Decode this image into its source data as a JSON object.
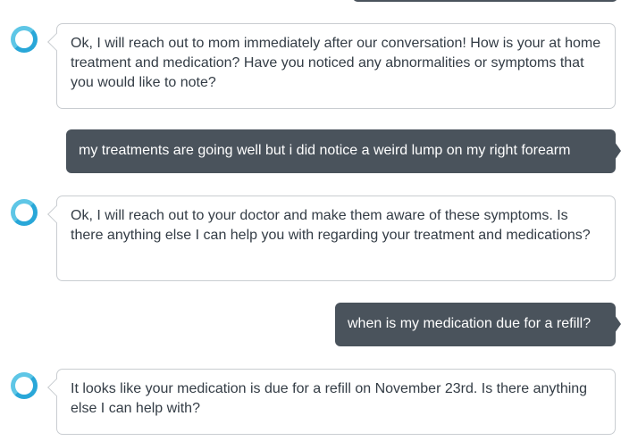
{
  "colors": {
    "user_bubble": "#4a535c",
    "assistant_border": "#c9cdd1",
    "assistant_text": "#333c45",
    "assistant_icon": "#5ec6e6"
  },
  "icons": {
    "assistant": "alexa-ring-icon"
  },
  "messages": [
    {
      "sender": "assistant",
      "text": "Ok, I will reach out to mom immediately after our conversation! How is your at home treatment and medication? Have you noticed any abnormalities or symptoms that you would like to note?"
    },
    {
      "sender": "user",
      "text": "my treatments are going well but i did notice a weird lump on my right forearm"
    },
    {
      "sender": "assistant",
      "text": "Ok, I will reach out to your doctor and make them aware of these symptoms. Is there anything else I can help you with regarding your treatment and medications?"
    },
    {
      "sender": "user",
      "text": "when is my medication due for a refill?"
    },
    {
      "sender": "assistant",
      "text": "It looks like your medication is due for a refill on November 23rd. Is there anything else I can help with?"
    }
  ]
}
